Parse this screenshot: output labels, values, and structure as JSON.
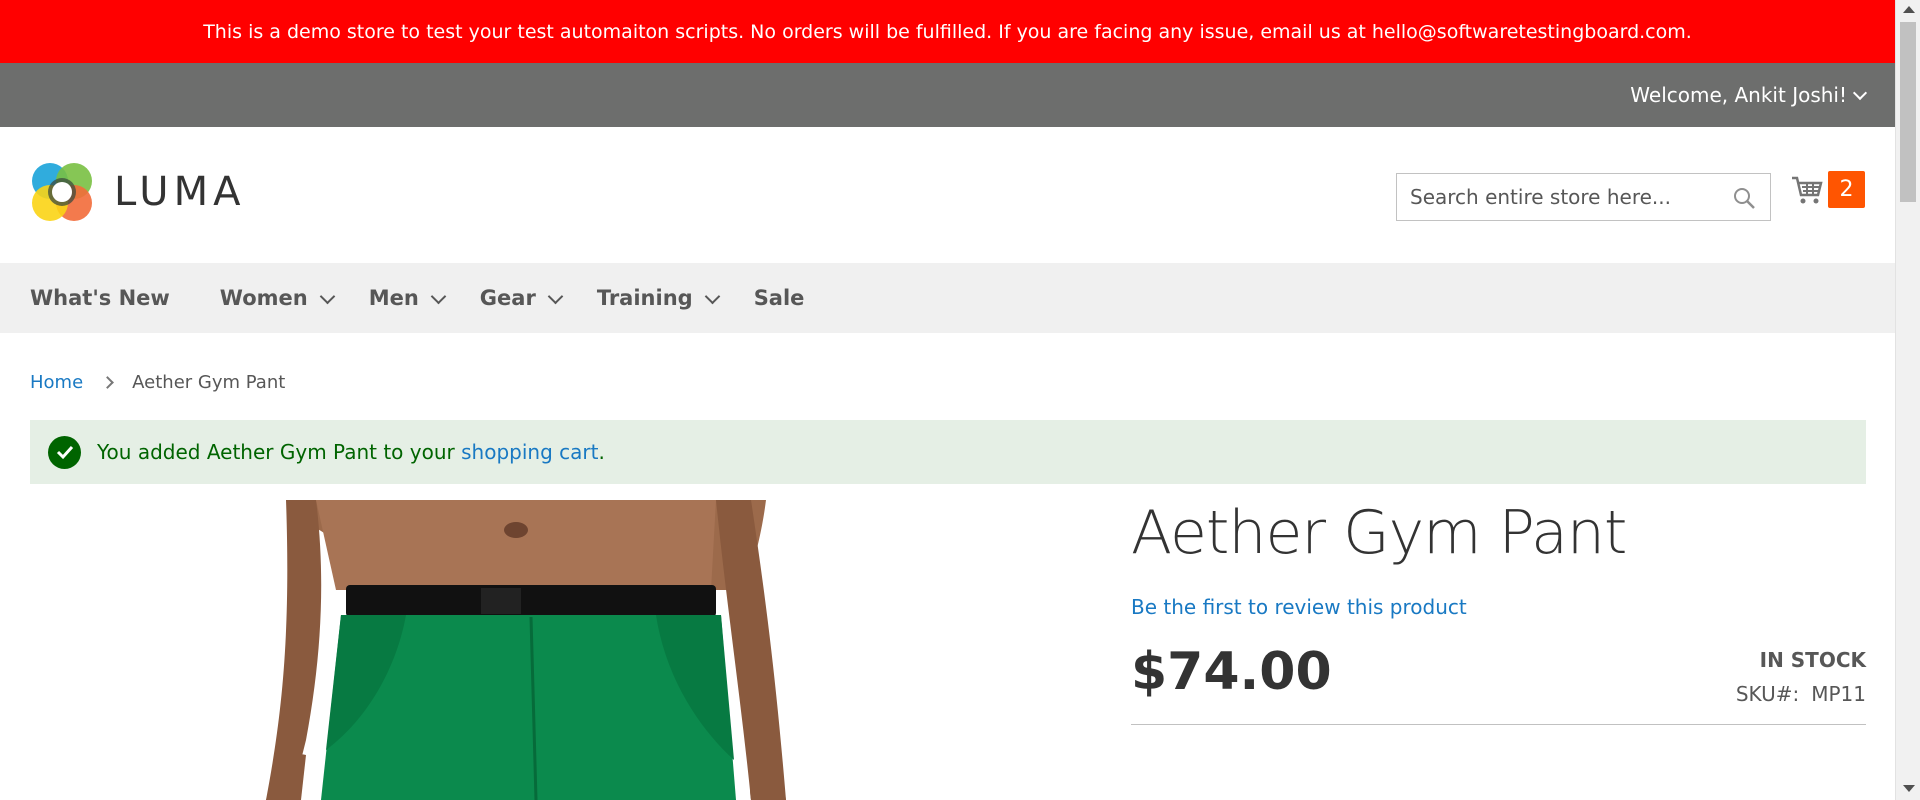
{
  "demo_banner": {
    "text": "This is a demo store to test your test automaiton scripts. No orders will be fulfilled. If you are facing any issue, email us at hello@softwaretestingboard.com.",
    "color": "#ff0000"
  },
  "topbar": {
    "welcome": "Welcome, Ankit Joshi!"
  },
  "header": {
    "logo_text": "LUMA",
    "search_placeholder": "Search entire store here...",
    "cart_count": "2"
  },
  "nav": {
    "items": [
      {
        "label": "What's New"
      },
      {
        "label": "Women"
      },
      {
        "label": "Men"
      },
      {
        "label": "Gear"
      },
      {
        "label": "Training"
      },
      {
        "label": "Sale"
      }
    ]
  },
  "breadcrumb": {
    "home": "Home",
    "current": "Aether Gym Pant"
  },
  "message": {
    "prefix": "You added Aether Gym Pant to your ",
    "link": "shopping cart",
    "suffix": "."
  },
  "product": {
    "title": "Aether Gym Pant",
    "review_link": "Be the first to review this product",
    "price": "$74.00",
    "stock": "IN STOCK",
    "sku_label": "SKU#:",
    "sku_value": "MP11"
  },
  "colors": {
    "accent_link": "#1979c3",
    "cart_badge": "#ff5501",
    "topbar": "#6d6e6d",
    "success_bg": "#e5efe5",
    "success_text": "#006400"
  }
}
